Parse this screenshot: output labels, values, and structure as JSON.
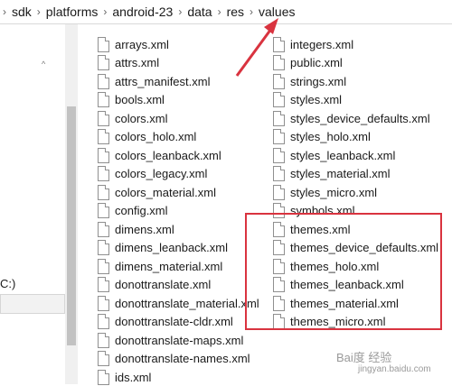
{
  "breadcrumb": [
    "sdk",
    "platforms",
    "android-23",
    "data",
    "res",
    "values"
  ],
  "nav": {
    "drive_label": "C:)",
    "expand_glyph": "^"
  },
  "files_col1": [
    "arrays.xml",
    "attrs.xml",
    "attrs_manifest.xml",
    "bools.xml",
    "colors.xml",
    "colors_holo.xml",
    "colors_leanback.xml",
    "colors_legacy.xml",
    "colors_material.xml",
    "config.xml",
    "dimens.xml",
    "dimens_leanback.xml",
    "dimens_material.xml",
    "donottranslate.xml",
    "donottranslate_material.xml",
    "donottranslate-cldr.xml",
    "donottranslate-maps.xml",
    "donottranslate-names.xml",
    "ids.xml"
  ],
  "files_col2": [
    "integers.xml",
    "public.xml",
    "strings.xml",
    "styles.xml",
    "styles_device_defaults.xml",
    "styles_holo.xml",
    "styles_leanback.xml",
    "styles_material.xml",
    "styles_micro.xml",
    "symbols.xml",
    "themes.xml",
    "themes_device_defaults.xml",
    "themes_holo.xml",
    "themes_leanback.xml",
    "themes_material.xml",
    "themes_micro.xml"
  ],
  "annotation": {
    "color": "#d9333f"
  },
  "watermark": {
    "text": "Bai度 经验",
    "sub": "jingyan.baidu.com"
  }
}
